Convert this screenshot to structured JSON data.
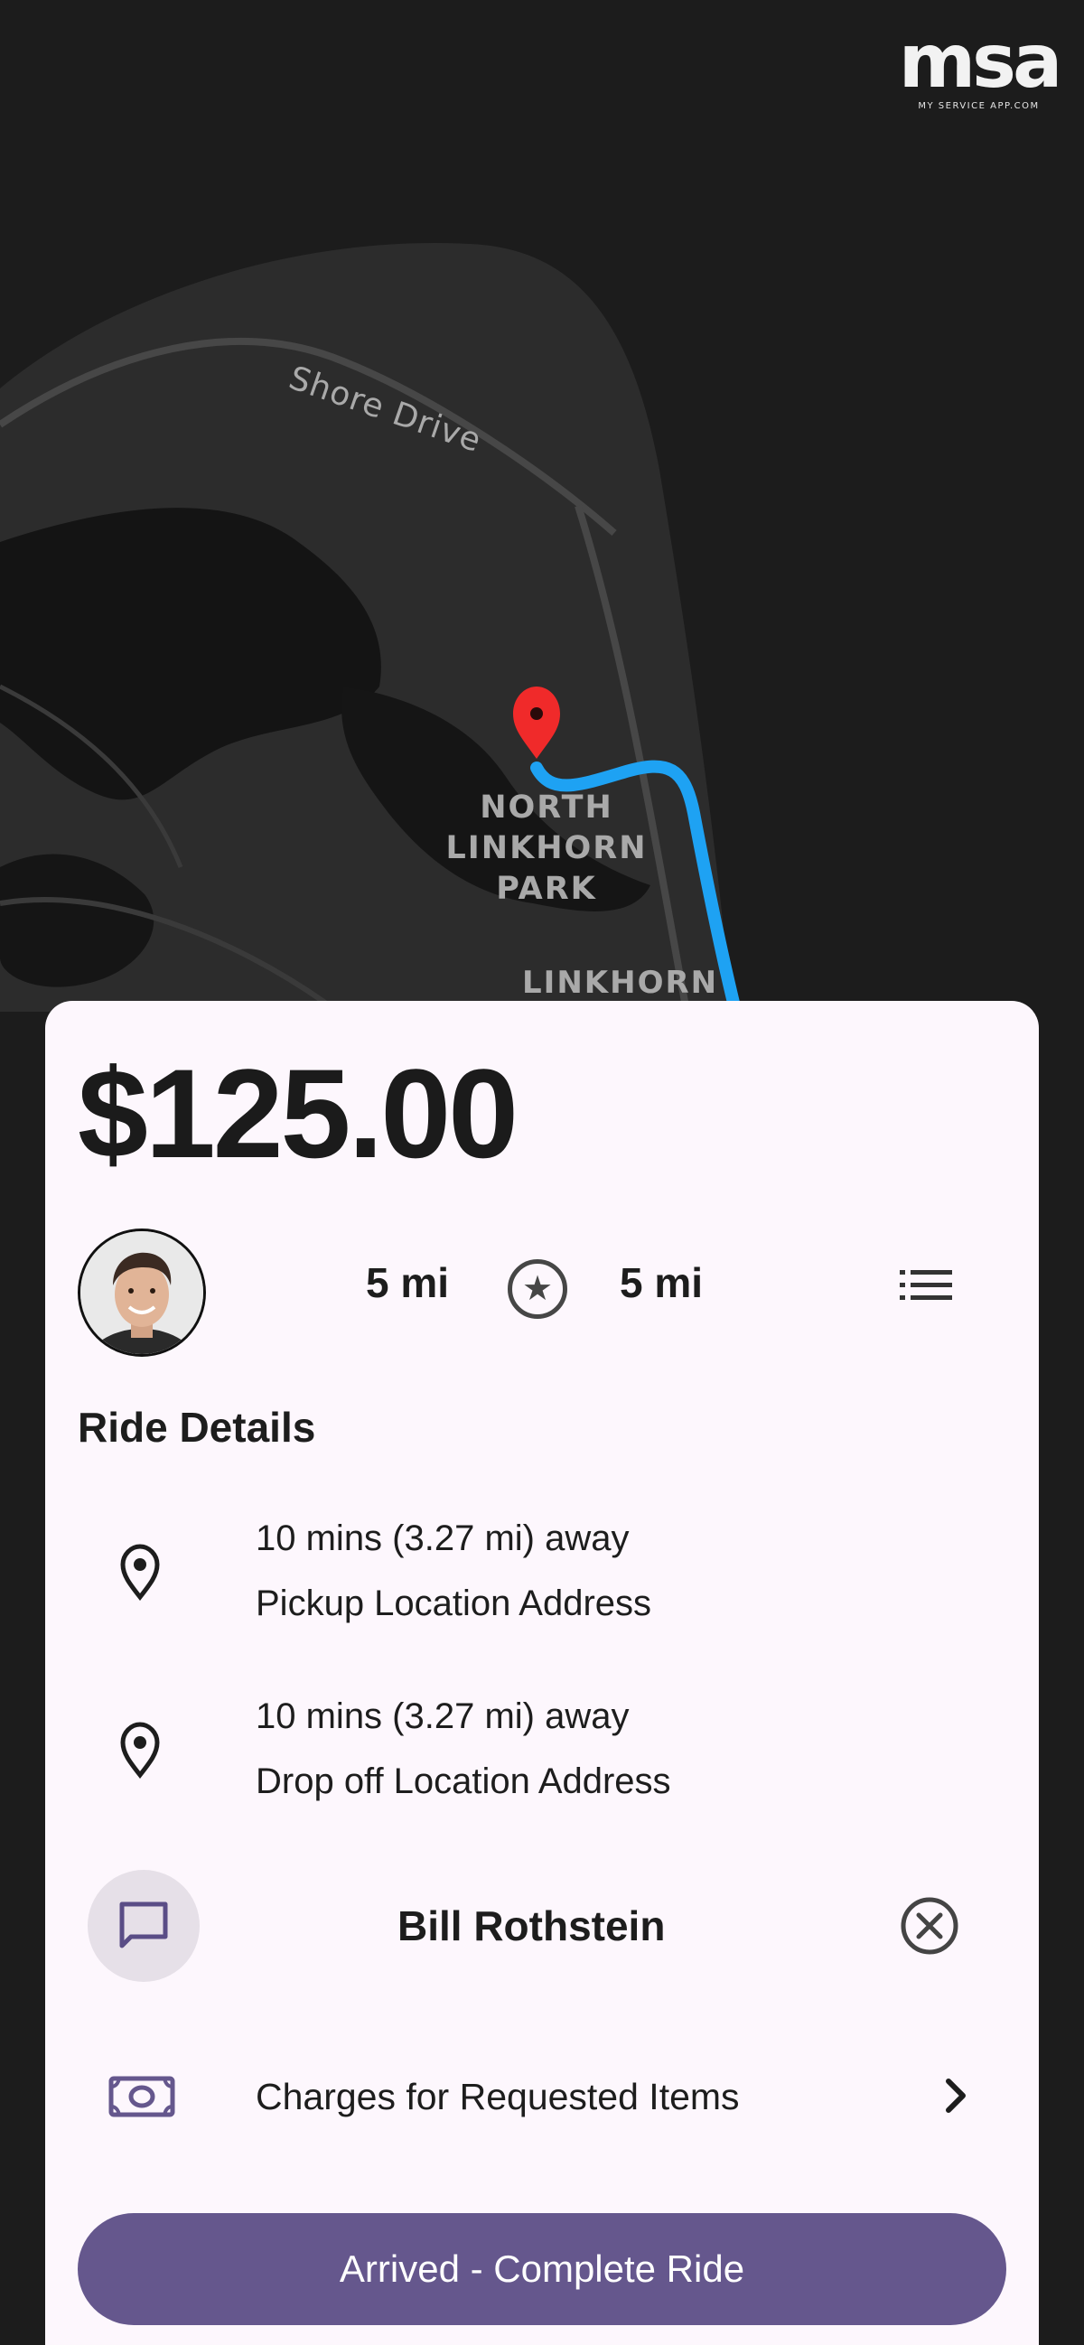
{
  "branding": {
    "logo_text": "msa",
    "logo_subtitle": "MY SERVICE APP.COM"
  },
  "map": {
    "labels": {
      "road": "Shore Drive",
      "park": "NORTH LINKHORN PARK",
      "area": "LINKHORN"
    },
    "route_color": "#1ea2f3",
    "pin_color": "#f02a2a"
  },
  "ride": {
    "fare": "$125.00",
    "distance_left": "5 mi",
    "distance_right": "5 mi",
    "details_heading": "Ride Details",
    "pickup": {
      "eta": "10 mins (3.27 mi) away",
      "address": "Pickup Location Address"
    },
    "dropoff": {
      "eta": "10 mins (3.27 mi) away",
      "address": "Drop off Location Address"
    },
    "rider_name": "Bill Rothstein",
    "charges_label": "Charges for Requested Items",
    "complete_button": "Arrived - Complete Ride"
  },
  "icons": {
    "rating": "star-icon",
    "menu": "list-icon",
    "location": "location-pin-icon",
    "chat": "chat-icon",
    "cancel": "cancel-icon",
    "money": "money-icon",
    "forward": "chevron-right-icon"
  },
  "colors": {
    "accent": "#65578d",
    "sheet_bg": "#fdf7fd",
    "map_bg": "#1c1c1c"
  }
}
